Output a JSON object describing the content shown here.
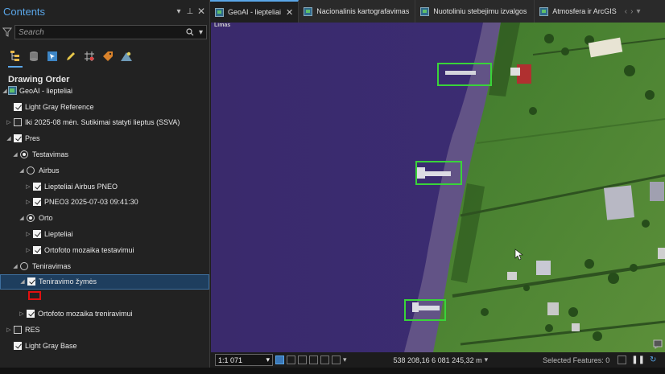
{
  "contents": {
    "title": "Contents",
    "search_placeholder": "Search",
    "section_title": "Drawing Order",
    "layers": [
      {
        "label": "GeoAI - liepteliai"
      },
      {
        "label": "Light Gray Reference"
      },
      {
        "label": "Iki 2025-08 mėn. Sutikimai statyti lieptus (SSVA)"
      },
      {
        "label": "Pres"
      },
      {
        "label": "Testavimas"
      },
      {
        "label": "Airbus"
      },
      {
        "label": "Liepteliai Airbus PNEO"
      },
      {
        "label": "PNEO3 2025-07-03 09:41:30"
      },
      {
        "label": "Orto"
      },
      {
        "label": "Liepteliai"
      },
      {
        "label": "Ortofoto mozaika testavimui"
      },
      {
        "label": "Teniravimas"
      },
      {
        "label": "Teniravimo žymės"
      },
      {
        "label": "Ortofoto mozaika treniravimui"
      },
      {
        "label": "RES"
      },
      {
        "label": "Light Gray Base"
      }
    ]
  },
  "tabs": [
    {
      "label": "GeoAI - liepteliai"
    },
    {
      "label": "Nacionalinis kartografavimas"
    },
    {
      "label": "Nuotoliniu stebejimu izvalgos"
    },
    {
      "label": "Atmosfera ir ArcGIS"
    }
  ],
  "map": {
    "corner_label": "Limas"
  },
  "status": {
    "scale": "1:1 071",
    "coordinates": "538 208,16 6 081 245,32 m",
    "selected_features": "Selected Features: 0"
  },
  "colors": {
    "accent": "#5aa6e8",
    "detection_box": "#39d439",
    "symbol_outline": "#e01010",
    "water": "#3b2c6e"
  }
}
